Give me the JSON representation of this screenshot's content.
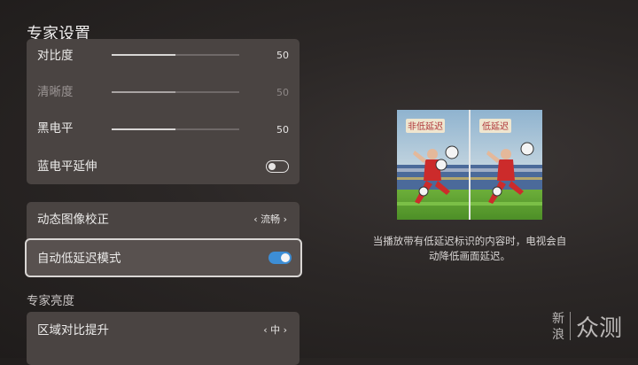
{
  "page_title": "专家设置",
  "settings": {
    "contrast": {
      "label": "对比度",
      "value": "50",
      "level": 0.5
    },
    "sharpness": {
      "label": "清晰度",
      "value": "50",
      "level": 0.5
    },
    "black_level": {
      "label": "黑电平",
      "value": "50",
      "level": 0.5
    },
    "blue_stretch": {
      "label": "蓝电平延伸",
      "enabled": false
    },
    "motion_correction": {
      "label": "动态图像校正",
      "value": "流畅"
    },
    "auto_low_latency": {
      "label": "自动低延迟模式",
      "enabled": true
    },
    "section_brightness": "专家亮度",
    "local_contrast": {
      "label": "区域对比提升",
      "value": "中"
    }
  },
  "preview": {
    "left_tag": "非低延迟",
    "right_tag": "低延迟",
    "description": "当播放带有低延迟标识的内容时，电视会自动降低画面延迟。"
  },
  "watermark": {
    "line1": "新",
    "line2": "浪",
    "brand": "众测"
  },
  "colors": {
    "accent": "#3d8ed6",
    "panel": "#4a4442",
    "background": "#2b2726"
  }
}
